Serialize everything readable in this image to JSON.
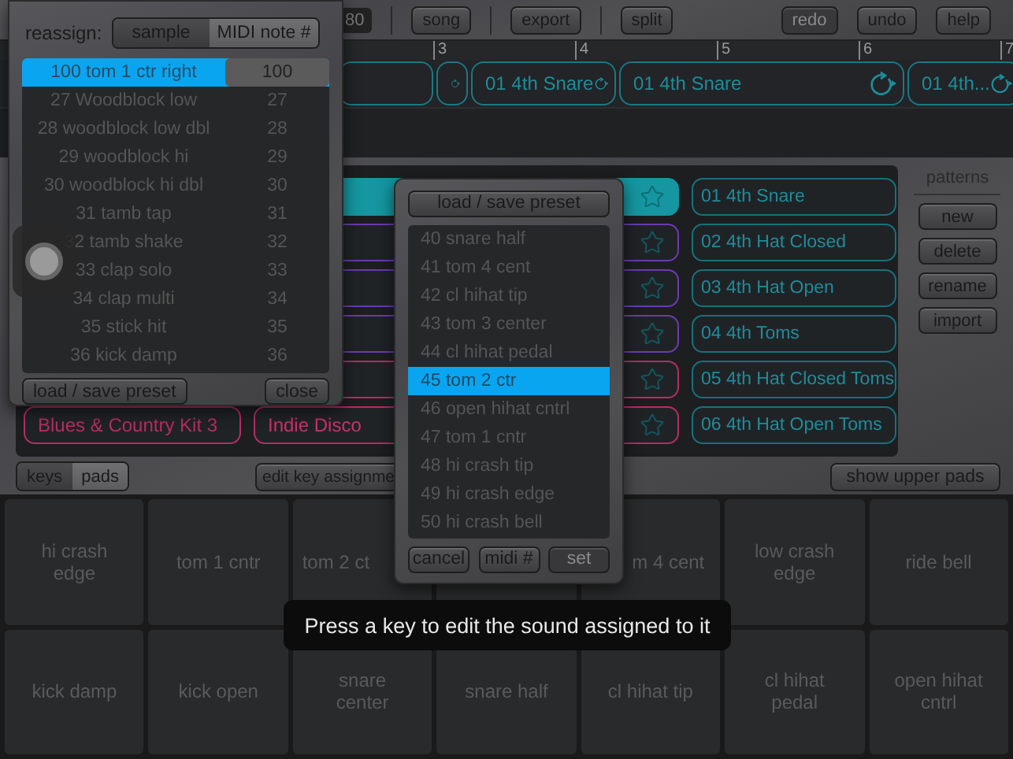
{
  "toolbar": {
    "tempo": "80",
    "buttons": [
      {
        "label": "song",
        "disabled": false
      },
      {
        "label": "export",
        "disabled": false
      },
      {
        "label": "split",
        "disabled": false
      },
      {
        "label": "redo",
        "disabled": true
      },
      {
        "label": "undo",
        "disabled": false
      },
      {
        "label": "help",
        "disabled": false
      }
    ]
  },
  "ruler": {
    "marks": [
      "3",
      "4",
      "5",
      "6",
      "7"
    ]
  },
  "track": {
    "clips": [
      {
        "kind": "blank"
      },
      {
        "kind": "loop"
      },
      {
        "kind": "loop",
        "label": "01 4th Snare"
      },
      {
        "kind": "loop",
        "label": "01 4th Snare"
      },
      {
        "kind": "loop",
        "label": "01 4th..."
      }
    ]
  },
  "kits_left": [
    {
      "color": "#b82c63",
      "label": "Blues & Country Kit 3"
    }
  ],
  "kits_right": [
    {
      "color": "#1596a0",
      "selected": true
    },
    {
      "color": "#6b3bb0",
      "selected": false
    },
    {
      "color": "#6b3bb0",
      "selected": false
    },
    {
      "color": "#6b3bb0",
      "selected": false
    },
    {
      "color": "#b82c63",
      "selected": false
    },
    {
      "color": "#b82c63",
      "label": "Indie Disco",
      "selected": false
    }
  ],
  "patterns": {
    "title": "patterns",
    "items": [
      "01 4th Snare",
      "02 4th Hat Closed",
      "03 4th Hat Open",
      "04 4th Toms",
      "05 4th Hat Closed Toms",
      "06 4th Hat Open Toms"
    ],
    "buttons": [
      "new",
      "delete",
      "rename",
      "import"
    ]
  },
  "bottom_bar": {
    "view": [
      {
        "label": "keys",
        "selected": false
      },
      {
        "label": "pads",
        "selected": true
      }
    ],
    "edit_button": "edit key assignme",
    "show_button": "show upper pads"
  },
  "pads": [
    [
      {
        "kind": "full",
        "label": "hi crash edge"
      },
      {
        "kind": "full",
        "label": "tom 1 cntr"
      },
      {
        "kind": "cut-right",
        "label": "tom 2 ct"
      },
      {
        "kind": "hidden"
      },
      {
        "kind": "cut-left",
        "label": "m 4 cent"
      },
      {
        "kind": "full",
        "label": "low crash edge"
      },
      {
        "kind": "full",
        "label": "ride bell"
      }
    ],
    [
      {
        "kind": "full",
        "label": "kick damp"
      },
      {
        "kind": "full",
        "label": "kick open"
      },
      {
        "kind": "full",
        "label": "snare center"
      },
      {
        "kind": "full",
        "label": "snare half"
      },
      {
        "kind": "full",
        "label": "cl hihat tip"
      },
      {
        "kind": "full",
        "label": "cl hihat pedal"
      },
      {
        "kind": "full",
        "label": "open hihat cntrl"
      }
    ]
  ],
  "reassign_popup": {
    "label": "reassign:",
    "modes": [
      {
        "label": "sample",
        "selected": false
      },
      {
        "label": "MIDI note #",
        "selected": true
      }
    ],
    "rows": [
      {
        "name": "100 tom 1 ctr right",
        "note": "100",
        "selected": true
      },
      {
        "name": "27 Woodblock low",
        "note": "27",
        "selected": false
      },
      {
        "name": "28 woodblock low dbl",
        "note": "28",
        "selected": false
      },
      {
        "name": "29 woodblock hi",
        "note": "29",
        "selected": false
      },
      {
        "name": "30 woodblock hi dbl",
        "note": "30",
        "selected": false
      },
      {
        "name": "31 tamb tap",
        "note": "31",
        "selected": false
      },
      {
        "name": "32 tamb shake",
        "note": "32",
        "selected": false
      },
      {
        "name": "33 clap solo",
        "note": "33",
        "selected": false
      },
      {
        "name": "34 clap multi",
        "note": "34",
        "selected": false
      },
      {
        "name": "35 stick hit",
        "note": "35",
        "selected": false
      },
      {
        "name": "36 kick damp",
        "note": "36",
        "selected": false
      }
    ],
    "buttons": [
      "load / save preset",
      "close"
    ]
  },
  "sound_popup": {
    "header_button": "load / save preset",
    "items": [
      {
        "label": "40 snare half",
        "selected": false
      },
      {
        "label": "41 tom 4 cent",
        "selected": false
      },
      {
        "label": "42 cl hihat tip",
        "selected": false
      },
      {
        "label": "43 tom 3 center",
        "selected": false
      },
      {
        "label": "44 cl hihat pedal",
        "selected": false
      },
      {
        "label": "45 tom 2 ctr",
        "selected": true
      },
      {
        "label": "46 open hihat cntrl",
        "selected": false
      },
      {
        "label": "47 tom 1 cntr",
        "selected": false
      },
      {
        "label": "48 hi crash tip",
        "selected": false
      },
      {
        "label": "49 hi crash edge",
        "selected": false
      },
      {
        "label": "50 hi crash bell",
        "selected": false
      }
    ],
    "buttons": [
      {
        "label": "cancel",
        "disabled": false
      },
      {
        "label": "midi #",
        "disabled": false
      },
      {
        "label": "set",
        "disabled": true
      }
    ]
  },
  "toast": "Press a key to edit the sound assigned to it"
}
